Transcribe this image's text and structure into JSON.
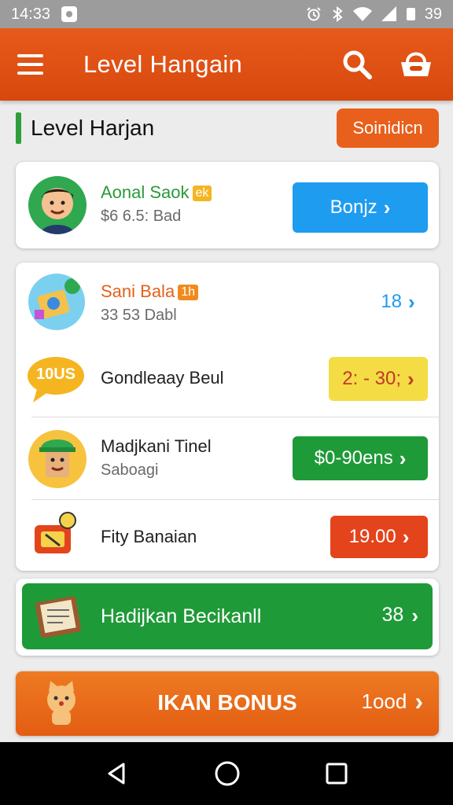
{
  "status_bar": {
    "time": "14:33",
    "battery": "39"
  },
  "app_bar": {
    "title": "Level Hangain"
  },
  "section": {
    "title": "Level Harjan",
    "button_label": "Soinidicn"
  },
  "items": [
    {
      "name": "Aonal Saok",
      "tag": "ek",
      "subtitle": "$6 6.5: Bad",
      "action_label": "Bonjz",
      "action_color": "#1e9cf0"
    },
    {
      "name": "Sani Bala",
      "tag": "1h",
      "subtitle": "33 53 Dabl",
      "action_label": "18",
      "action_color": "#1e9cf0"
    },
    {
      "name": "Gondleaay Beul",
      "avatar_text": "10US",
      "action_label": "2: - 30;",
      "action_color": "#f4dc44"
    },
    {
      "name": "Madjkani Tinel",
      "subtitle": "Saboagi",
      "action_label": "$0-90ens",
      "action_color": "#1f9a38"
    },
    {
      "name": "Fity Banaian",
      "action_label": "19.00",
      "action_color": "#e4441c"
    }
  ],
  "green_banner": {
    "label": "Hadijkan Becikanll",
    "value": "38"
  },
  "bonus_banner": {
    "label": "IKAN BONUS",
    "value": "1ood"
  }
}
